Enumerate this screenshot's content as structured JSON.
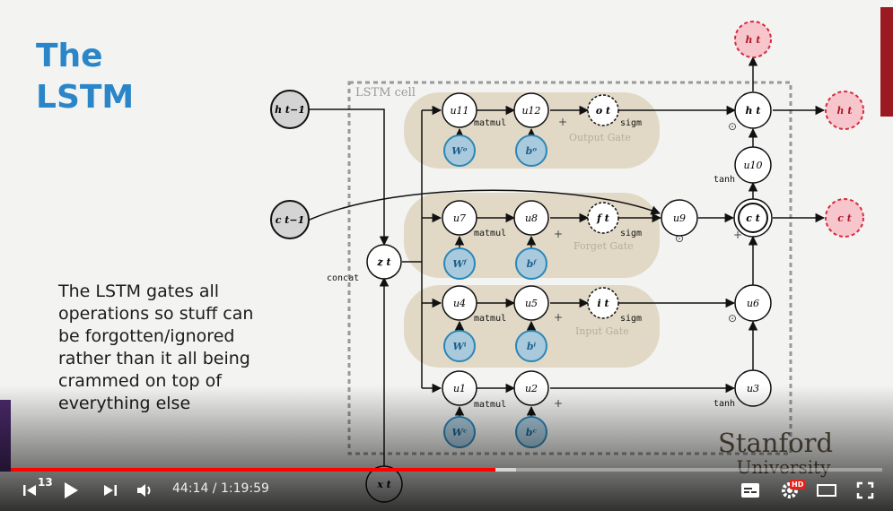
{
  "slide": {
    "title": "The\nLSTM",
    "body": "The LSTM gates all\noperations so stuff can\nbe forgotten/ignored\nrather than it all being\ncrammed on top of\neverything else"
  },
  "diagram": {
    "cell_label": "LSTM cell",
    "nodes": {
      "h_prev": "h t−1",
      "c_prev": "c t−1",
      "x": "x t",
      "z": "z t",
      "u11": "u11",
      "u12": "u12",
      "o": "o t",
      "u7": "u7",
      "u8": "u8",
      "f": "f t",
      "u9": "u9",
      "u4": "u4",
      "u5": "u5",
      "i": "i t",
      "u6": "u6",
      "u1": "u1",
      "u2": "u2",
      "u3": "u3",
      "u10": "u10",
      "h": "h t",
      "c": "c t",
      "h_out_top": "h t",
      "h_out": "h t",
      "c_out": "c t",
      "Wo": "Wᵒ",
      "bo": "bᵒ",
      "Wf": "Wᶠ",
      "bf": "bᶠ",
      "Wi": "Wⁱ",
      "bi": "bⁱ",
      "Wc": "Wᶜ",
      "bc": "bᶜ"
    },
    "op_labels": {
      "concat": "concat",
      "matmul": "matmul",
      "sigm": "sigm",
      "tanh": "tanh",
      "plus": "+",
      "odot": "⊙"
    },
    "gate_labels": {
      "output": "Output Gate",
      "forget": "Forget Gate",
      "input": "Input Gate"
    }
  },
  "watermark": {
    "line1": "Stanford",
    "line2": "University"
  },
  "player": {
    "chapter_badge": "13",
    "current_time": "44:14",
    "separator": " / ",
    "duration": "1:19:59",
    "hd_badge": "HD",
    "progress_fraction": 0.556,
    "colors": {
      "played": "#ff0000",
      "accent_title": "#2a86c8"
    }
  }
}
